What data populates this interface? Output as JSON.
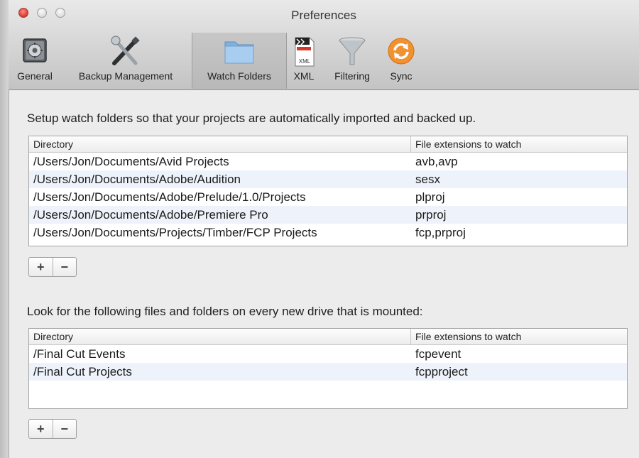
{
  "window": {
    "title": "Preferences"
  },
  "toolbar": {
    "items": [
      {
        "label": "General",
        "icon": "general-icon"
      },
      {
        "label": "Backup Management",
        "icon": "tools-icon"
      },
      {
        "label": "Watch Folders",
        "icon": "folder-icon",
        "selected": true
      },
      {
        "label": "XML",
        "icon": "xml-icon"
      },
      {
        "label": "Filtering",
        "icon": "funnel-icon"
      },
      {
        "label": "Sync",
        "icon": "sync-icon"
      }
    ]
  },
  "watch": {
    "instruction": "Setup watch folders so that your projects are automatically imported and backed up.",
    "columns": [
      "Directory",
      "File extensions to watch"
    ],
    "rows": [
      {
        "dir": "/Users/Jon/Documents/Avid Projects",
        "ext": "avb,avp"
      },
      {
        "dir": "/Users/Jon/Documents/Adobe/Audition",
        "ext": "sesx"
      },
      {
        "dir": "/Users/Jon/Documents/Adobe/Prelude/1.0/Projects",
        "ext": "plproj"
      },
      {
        "dir": "/Users/Jon/Documents/Adobe/Premiere Pro",
        "ext": "prproj"
      },
      {
        "dir": "/Users/Jon/Documents/Projects/Timber/FCP Projects",
        "ext": "fcp,prproj"
      }
    ],
    "add_label": "+",
    "remove_label": "−"
  },
  "drives": {
    "instruction": "Look for the following files and folders on every new drive that is mounted:",
    "columns": [
      "Directory",
      "File extensions to watch"
    ],
    "rows": [
      {
        "dir": "/Final Cut Events",
        "ext": "fcpevent"
      },
      {
        "dir": "/Final Cut Projects",
        "ext": "fcpproject"
      }
    ],
    "add_label": "+",
    "remove_label": "−"
  },
  "colors": {
    "selected_tab": "#b8b8b8",
    "alt_row": "#eef3fb",
    "sync_orange": "#f2912f"
  }
}
